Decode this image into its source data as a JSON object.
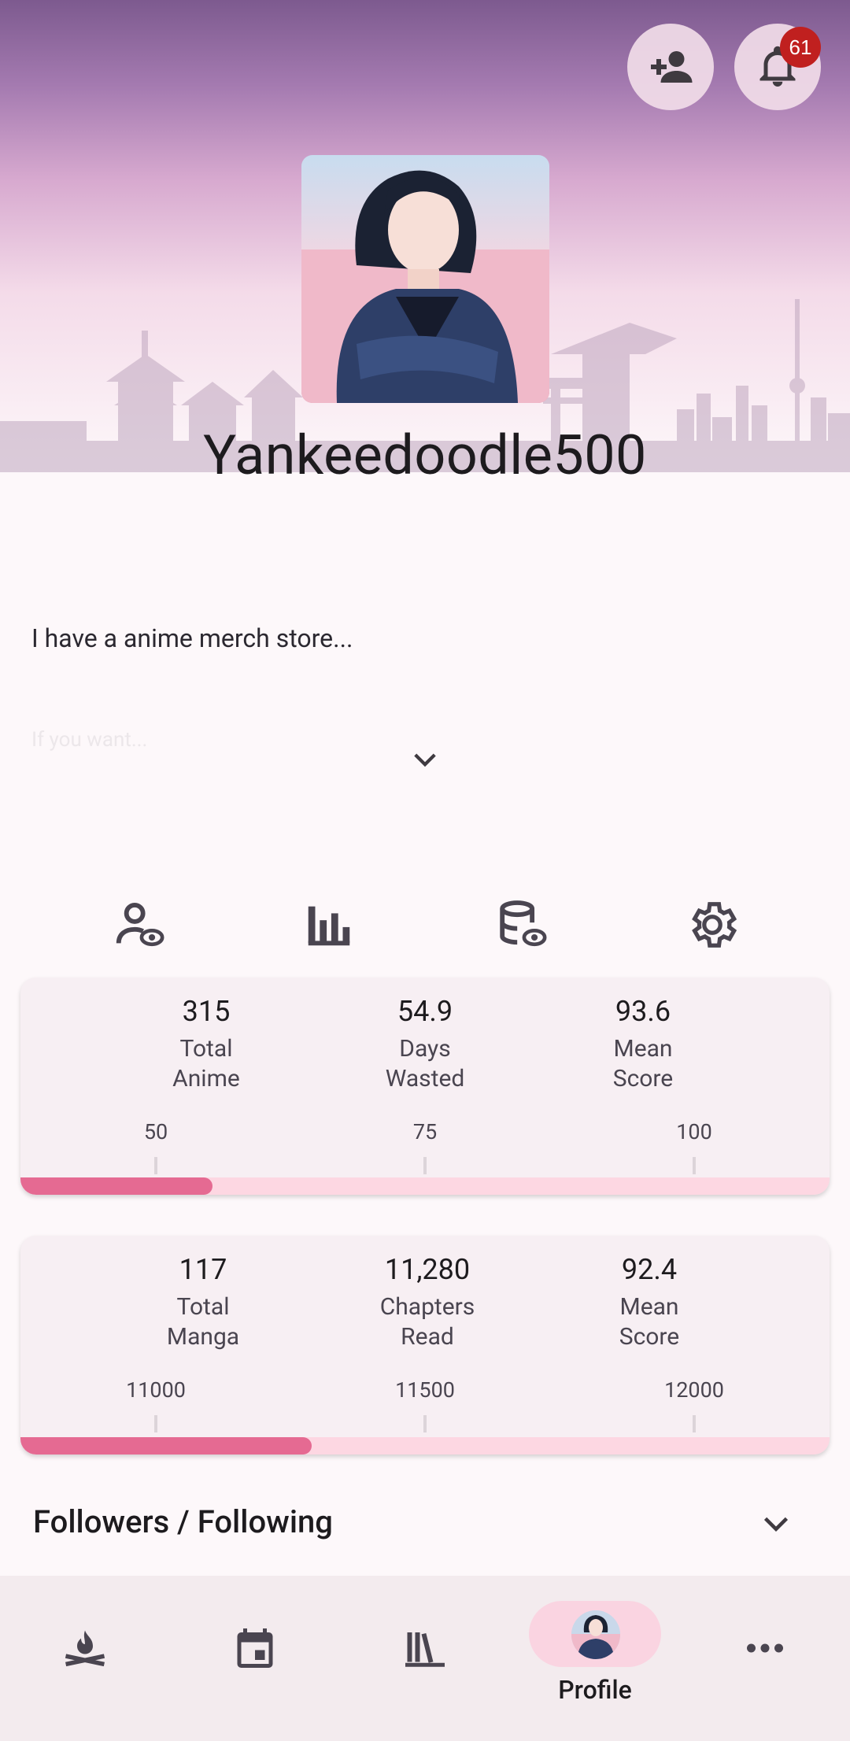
{
  "header": {
    "add_friend_icon": "person-add-icon",
    "notifications_icon": "bell-icon",
    "notification_count": "61"
  },
  "profile": {
    "username": "Yankeedoodle500",
    "bio": "I have a anime merch store...",
    "bio_faded": "If you want..."
  },
  "tabs": [
    {
      "icon": "user-watch-icon"
    },
    {
      "icon": "bar-chart-icon"
    },
    {
      "icon": "database-watch-icon"
    },
    {
      "icon": "gear-icon"
    }
  ],
  "anime_stats": {
    "total": {
      "value": "315",
      "label": "Total\nAnime"
    },
    "days": {
      "value": "54.9",
      "label": "Days\nWasted"
    },
    "mean": {
      "value": "93.6",
      "label": "Mean\nScore"
    },
    "ticks": [
      "50",
      "75",
      "100"
    ],
    "progress_fraction": 0.237
  },
  "manga_stats": {
    "total": {
      "value": "117",
      "label": "Total\nManga"
    },
    "chapters": {
      "value": "11,280",
      "label": "Chapters\nRead"
    },
    "mean": {
      "value": "92.4",
      "label": "Mean\nScore"
    },
    "ticks": [
      "11000",
      "11500",
      "12000"
    ],
    "progress_fraction": 0.36
  },
  "followers": {
    "label": "Followers / Following"
  },
  "bottom_nav": {
    "items": [
      {
        "icon": "campfire-icon"
      },
      {
        "icon": "calendar-icon"
      },
      {
        "icon": "library-icon"
      },
      {
        "icon": "avatar",
        "label": "Profile"
      },
      {
        "icon": "more-horizontal-icon"
      }
    ]
  },
  "colors": {
    "accent": "#e56a92",
    "track": "#fdd7e2",
    "badge": "#c0201f"
  }
}
